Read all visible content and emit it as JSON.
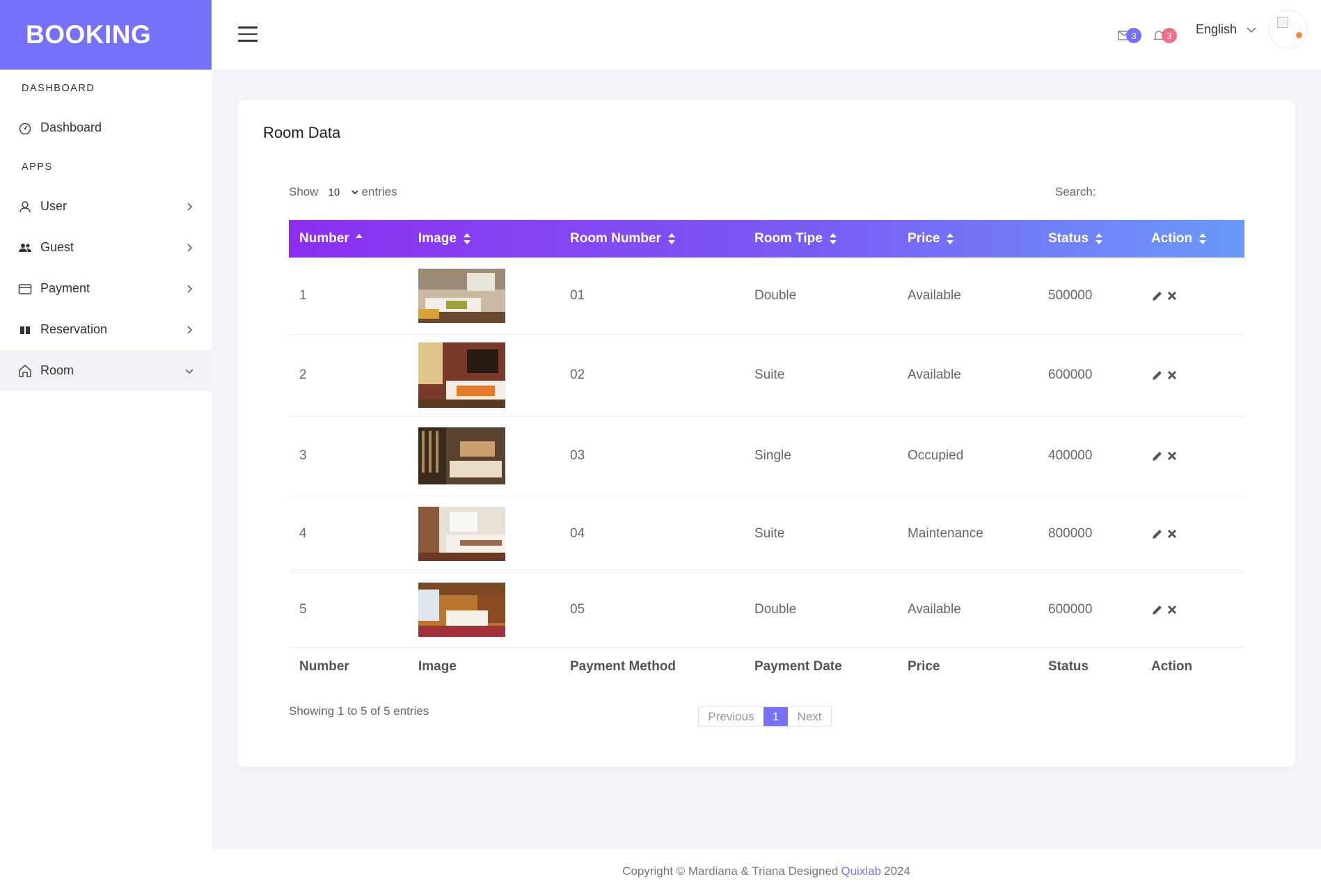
{
  "brand": {
    "title": "BOOKING",
    "color": "#7571f9"
  },
  "sidebar": {
    "section_dashboard": "DASHBOARD",
    "section_apps": "APPS",
    "items": [
      {
        "label": "Dashboard",
        "icon": "speedometer-icon"
      },
      {
        "label": "User",
        "icon": "user-icon"
      },
      {
        "label": "Guest",
        "icon": "people-icon"
      },
      {
        "label": "Payment",
        "icon": "wallet-icon"
      },
      {
        "label": "Reservation",
        "icon": "book-icon"
      },
      {
        "label": "Room",
        "icon": "home-icon",
        "active": true
      }
    ]
  },
  "topbar": {
    "mail_count": "3",
    "notification_count": "3",
    "mail_badge_color": "#7571f9",
    "notification_badge_color": "#f26f88",
    "language": "English"
  },
  "card": {
    "title": "Room Data",
    "show_label": "Show",
    "entries_value": "10",
    "entries_label": "entries",
    "search_label": "Search:",
    "search_value": "",
    "columns": [
      "Number",
      "Image",
      "Room Number",
      "Room Tipe",
      "Price",
      "Status",
      "Action"
    ],
    "footer_columns": [
      "Number",
      "Image",
      "Payment Method",
      "Payment Date",
      "Price",
      "Status",
      "Action"
    ],
    "rows": [
      {
        "number": "1",
        "image": "hotel-room-photo",
        "room_number": "01",
        "room_type": "Double",
        "price": "Available",
        "status": "500000"
      },
      {
        "number": "2",
        "image": "hotel-room-photo",
        "room_number": "02",
        "room_type": "Suite",
        "price": "Available",
        "status": "600000"
      },
      {
        "number": "3",
        "image": "hotel-room-photo",
        "room_number": "03",
        "room_type": "Single",
        "price": "Occupied",
        "status": "400000"
      },
      {
        "number": "4",
        "image": "hotel-room-photo",
        "room_number": "04",
        "room_type": "Suite",
        "price": "Maintenance",
        "status": "800000"
      },
      {
        "number": "5",
        "image": "hotel-room-photo",
        "room_number": "05",
        "room_type": "Double",
        "price": "Available",
        "status": "600000"
      }
    ],
    "info": "Showing 1 to 5 of 5 entries",
    "pagination": {
      "previous": "Previous",
      "current": "1",
      "next": "Next"
    }
  },
  "footer": {
    "prefix": "Copyright © Mardiana & Triana Designed",
    "link": "Quixlab",
    "year": "2024"
  }
}
